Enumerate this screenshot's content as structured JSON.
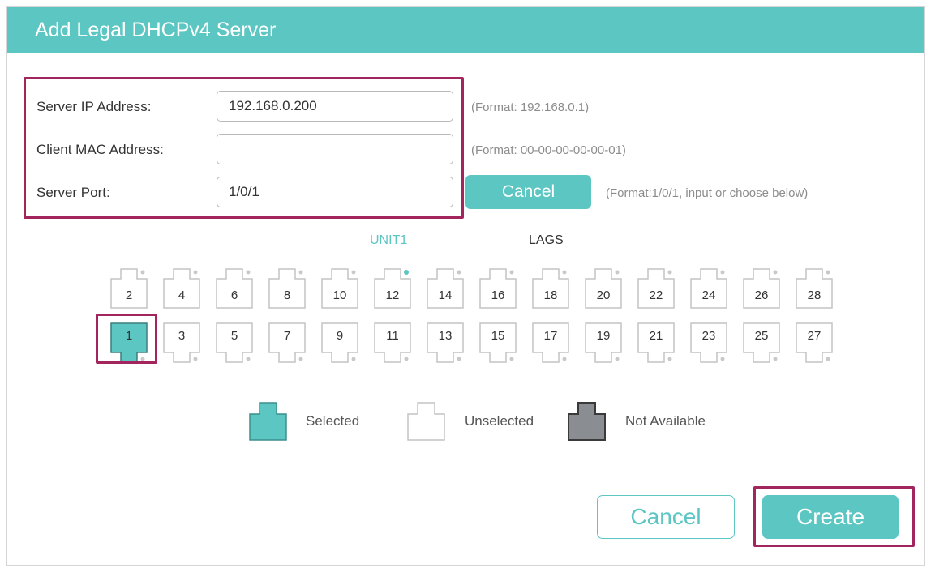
{
  "dialog": {
    "title": "Add Legal DHCPv4 Server"
  },
  "form": {
    "server_ip": {
      "label": "Server IP Address:",
      "value": "192.168.0.200",
      "hint": "(Format: 192.168.0.1)"
    },
    "client_mac": {
      "label": "Client MAC Address:",
      "value": "",
      "hint": "(Format: 00-00-00-00-00-01)"
    },
    "server_port": {
      "label": "Server Port:",
      "value": "1/0/1",
      "hint": "(Format:1/0/1, input or choose below)"
    },
    "port_cancel_label": "Cancel"
  },
  "tabs": [
    {
      "label": "UNIT1",
      "active": true
    },
    {
      "label": "LAGS",
      "active": false
    }
  ],
  "ports": {
    "top_row": [
      "2",
      "4",
      "6",
      "8",
      "10",
      "12",
      "14",
      "16",
      "18",
      "20",
      "22",
      "24",
      "26",
      "28"
    ],
    "bottom_row": [
      "1",
      "3",
      "5",
      "7",
      "9",
      "11",
      "13",
      "15",
      "17",
      "19",
      "21",
      "23",
      "25",
      "27"
    ],
    "selected": [
      "1"
    ],
    "link_up": [
      "12"
    ]
  },
  "legend": {
    "selected": "Selected",
    "unselected": "Unselected",
    "not_available": "Not Available"
  },
  "colors": {
    "accent": "#5cc6c3",
    "highlight": "#a3255e",
    "not_available": "#8a8d91"
  },
  "footer": {
    "cancel_label": "Cancel",
    "create_label": "Create"
  }
}
